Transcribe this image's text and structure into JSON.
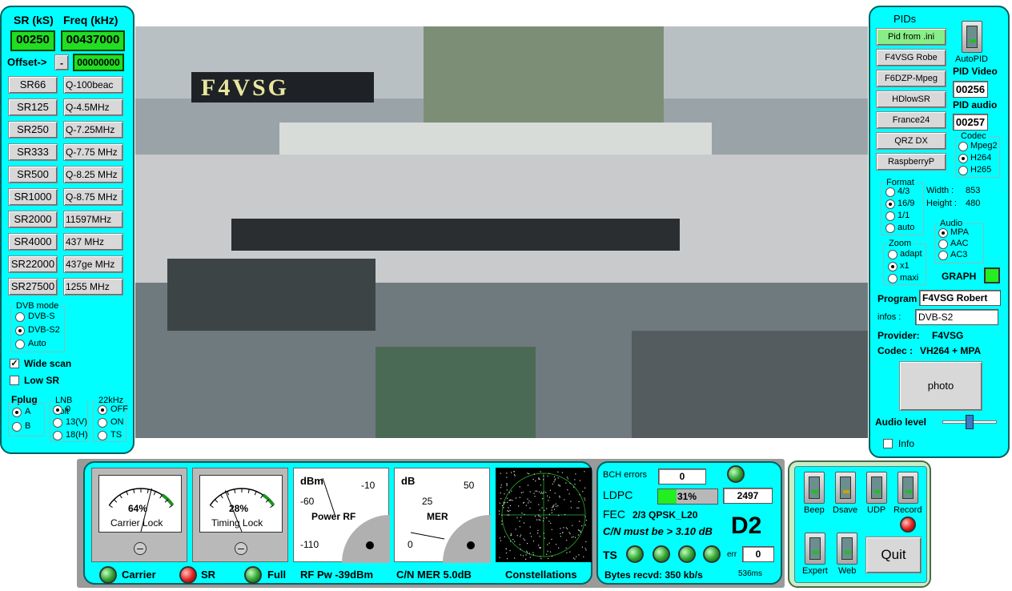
{
  "left": {
    "sr_header": "SR (kS)",
    "freq_header": "Freq (kHz)",
    "sr_value": "00250",
    "freq_value": "00437000",
    "offset_label": "Offset->",
    "offset_sign": "-",
    "offset_value": "00000000",
    "sr_buttons": [
      "SR66",
      "SR125",
      "SR250",
      "SR333",
      "SR500",
      "SR1000",
      "SR2000",
      "SR4000",
      "SR22000",
      "SR27500"
    ],
    "freq_buttons": [
      "Q-100beac",
      "Q-4.5MHz",
      "Q-7.25MHz",
      "Q-7.75 MHz",
      "Q-8.25 MHz",
      "Q-8.75 MHz",
      "11597MHz",
      "437 MHz",
      "437ge MHz",
      "1255 MHz"
    ],
    "dvb_mode": {
      "title": "DVB mode",
      "options": [
        "DVB-S",
        "DVB-S2",
        "Auto"
      ],
      "selected": 1
    },
    "wide_scan": "Wide scan",
    "low_sr": "Low SR",
    "fplug": {
      "title": "Fplug",
      "options": [
        "A",
        "B"
      ],
      "selected": 0
    },
    "lnb": {
      "title": "LNB volt",
      "options": [
        "0",
        "13(V)",
        "18(H)"
      ],
      "selected": 0
    },
    "k22": {
      "title": "22kHz",
      "options": [
        "OFF",
        "ON",
        "TS"
      ],
      "selected": 0
    }
  },
  "video": {
    "overlay_text": "F4VSG"
  },
  "right": {
    "pids_title": "PIDs",
    "preset_buttons": [
      "Pid from .ini",
      "F4VSG Robe",
      "F6DZP-Mpeg",
      "HDlowSR",
      "France24",
      "QRZ DX",
      "RaspberryP"
    ],
    "autopid": "AutoPID",
    "pid_video_label": "PID Video",
    "pid_video": "00256",
    "pid_audio_label": "PID audio",
    "pid_audio": "00257",
    "codec": {
      "title": "Codec",
      "options": [
        "Mpeg2",
        "H264",
        "H265"
      ],
      "selected": 1
    },
    "format": {
      "title": "Format",
      "options": [
        "4/3",
        "16/9",
        "1/1",
        "auto"
      ],
      "selected": 1
    },
    "width_label": "Width :",
    "width": "853",
    "height_label": "Height :",
    "height": "480",
    "audio": {
      "title": "Audio",
      "options": [
        "MPA",
        "AAC",
        "AC3"
      ],
      "selected": 0
    },
    "zoom": {
      "title": "Zoom",
      "options": [
        "adapt",
        "x1",
        "maxi"
      ],
      "selected": 1
    },
    "graph": "GRAPH",
    "program_label": "Program",
    "program": "F4VSG Robert",
    "infos_label": "infos :",
    "infos": "DVB-S2",
    "provider_label": "Provider:",
    "provider": "F4VSG",
    "codec_label": "Codec :",
    "codec_value": "VH264 + MPA",
    "photo": "photo",
    "audio_level": "Audio level",
    "info": "Info"
  },
  "bottom": {
    "meter1_pct": "64%",
    "meter1_label": "Carrier Lock",
    "meter1_fraction": 0.64,
    "meter2_pct": "28%",
    "meter2_label": "Timing Lock",
    "meter2_fraction": 0.28,
    "rf_unit": "dBm",
    "rf_ticks": [
      "-10",
      "-60",
      "-110"
    ],
    "rf_title": "Power RF",
    "mer_unit": "dB",
    "mer_ticks": [
      "50",
      "25",
      "0"
    ],
    "mer_title": "MER",
    "carrier": "Carrier",
    "sr": "SR",
    "full": "Full",
    "rf_pw": "RF Pw -39dBm",
    "cn_mer": "C/N MER 5.0dB",
    "constellations": "Constellations",
    "bch_label": "BCH errors",
    "bch": "0",
    "ldpc_label": "LDPC",
    "ldpc_pct": "31%",
    "ldpc_fraction": 0.31,
    "ldpc_value": "2497",
    "fec_label": "FEC",
    "fec_value": "2/3 QPSK_L20",
    "cn_must": "C/N must be > 3.10 dB",
    "d2": "D2",
    "ts_label": "TS",
    "err_label": "err",
    "err": "0",
    "bytes": "Bytes recvd:  350 kb/s",
    "ms": "536ms"
  },
  "controls": {
    "beep": "Beep",
    "dsave": "Dsave",
    "udp": "UDP",
    "record": "Record",
    "expert": "Expert",
    "web": "Web",
    "quit": "Quit"
  }
}
